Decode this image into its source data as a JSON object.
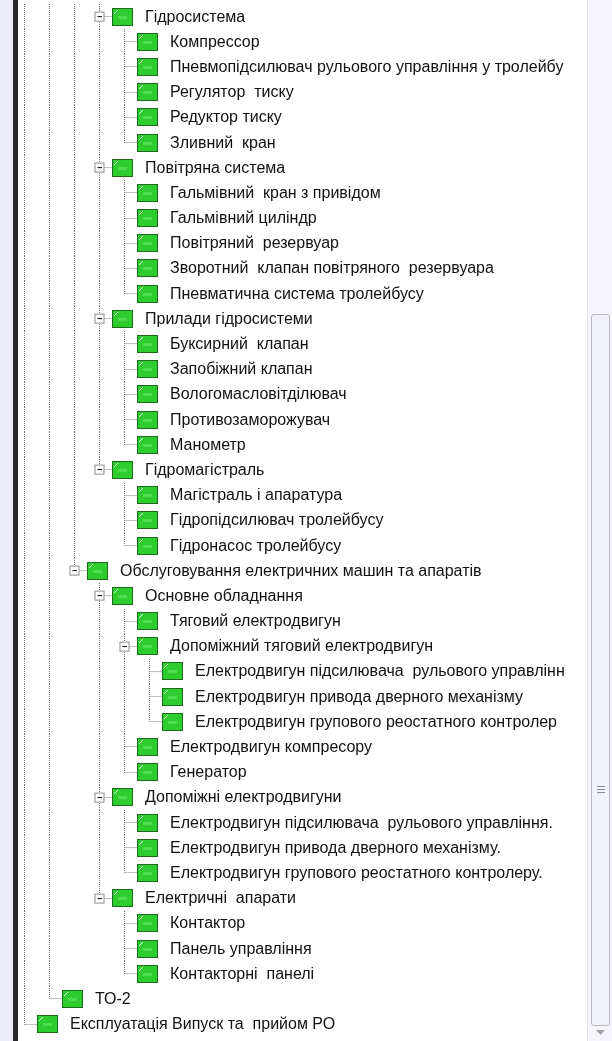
{
  "tree": [
    {
      "children": [
        {
          "children": [
            {
              "children": [
                {
                  "label": "Гідросистема",
                  "expanded": true,
                  "children": [
                    {
                      "label": "Компрессор"
                    },
                    {
                      "label": "Пневмопідсилювач рульового управління у тролейбу"
                    },
                    {
                      "label": "Регулятор  тиску"
                    },
                    {
                      "label": "Редуктор тиску"
                    },
                    {
                      "label": "Зливний  кран"
                    }
                  ]
                },
                {
                  "label": "Повітряна система",
                  "expanded": true,
                  "children": [
                    {
                      "label": "Гальмівний  кран з привідом"
                    },
                    {
                      "label": "Гальмівний циліндр"
                    },
                    {
                      "label": "Повітряний  резервуар"
                    },
                    {
                      "label": "Зворотний  клапан повітряного  резервуара"
                    },
                    {
                      "label": "Пневматична система тролейбусу"
                    }
                  ]
                },
                {
                  "label": "Прилади гідросистеми",
                  "expanded": true,
                  "children": [
                    {
                      "label": "Буксирний  клапан"
                    },
                    {
                      "label": "Запобіжний клапан"
                    },
                    {
                      "label": "Вологомасловітділювач"
                    },
                    {
                      "label": "Противозаморожувач"
                    },
                    {
                      "label": "Манометр"
                    }
                  ]
                },
                {
                  "label": "Гідромагістраль",
                  "expanded": true,
                  "children": [
                    {
                      "label": "Магістраль і апаратура"
                    },
                    {
                      "label": "Гідропідсилювач тролейбусу"
                    },
                    {
                      "label": "Гідронасос тролейбусу"
                    }
                  ]
                }
              ]
            },
            {
              "label": "Обслуговування електричних машин та апаратів",
              "expanded": true,
              "children": [
                {
                  "label": "Основне обладнання",
                  "expanded": true,
                  "children": [
                    {
                      "label": "Тяговий електродвигун"
                    },
                    {
                      "label": "Допоміжний тяговий електродвигун",
                      "expanded": true,
                      "children": [
                        {
                          "label": "Електродвигун підсилювача  рульового управлінн"
                        },
                        {
                          "label": "Електродвигун привода дверного механізму"
                        },
                        {
                          "label": "Електродвигун групового реостатного контролер"
                        }
                      ]
                    },
                    {
                      "label": "Електродвигун компресору"
                    },
                    {
                      "label": "Генератор"
                    }
                  ]
                },
                {
                  "label": "Допоміжні електродвигуни",
                  "expanded": true,
                  "children": [
                    {
                      "label": "Електродвигун підсилювача  рульового управління."
                    },
                    {
                      "label": "Електродвигун привода дверного механізму."
                    },
                    {
                      "label": "Електродвигун групового реостатного контролеру."
                    }
                  ]
                },
                {
                  "label": "Електричні  апарати",
                  "expanded": true,
                  "children": [
                    {
                      "label": "Контактор"
                    },
                    {
                      "label": "Панель управління"
                    },
                    {
                      "label": "Контакторні  панелі"
                    }
                  ]
                }
              ]
            }
          ]
        },
        {
          "label": "ТО-2"
        }
      ]
    },
    {
      "label": "Експлуатація Випуск та  прийом РО"
    }
  ]
}
